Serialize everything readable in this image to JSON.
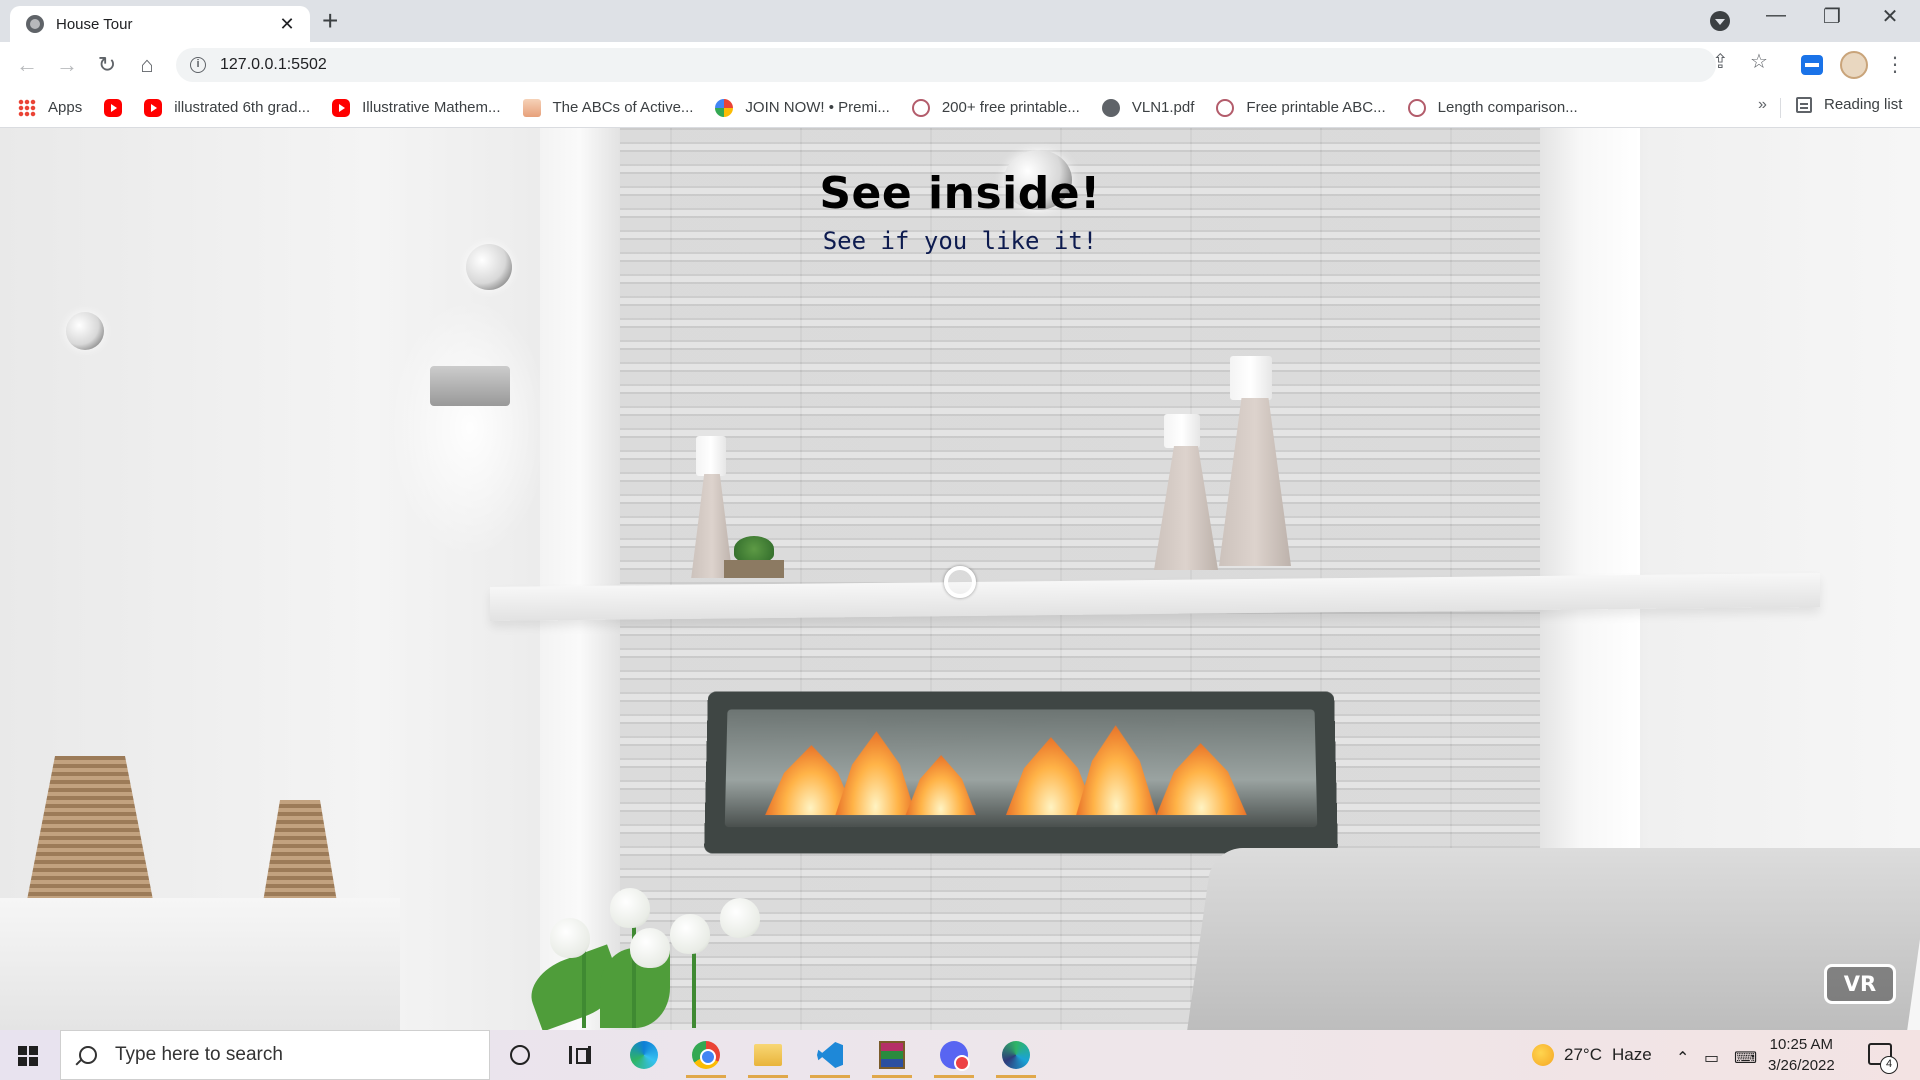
{
  "browser": {
    "tab_title": "House Tour",
    "tab_close": "✕",
    "new_tab": "+",
    "url": "127.0.0.1:5502",
    "window_controls": {
      "minimize": "—",
      "maximize": "❐",
      "close": "✕"
    },
    "nav": {
      "back": "←",
      "forward": "→",
      "reload": "↻",
      "home": "⌂"
    },
    "omnibox_actions": {
      "share": "⇪",
      "bookmark": "☆"
    },
    "menu": "⋮",
    "bookmarks": [
      {
        "label": "Apps",
        "icon": "apps-grid-icon"
      },
      {
        "label": "",
        "icon": "youtube-icon"
      },
      {
        "label": "illustrated 6th grad...",
        "icon": "youtube-icon"
      },
      {
        "label": "Illustrative Mathem...",
        "icon": "youtube-icon"
      },
      {
        "label": "The ABCs of Active...",
        "icon": "abc-icon"
      },
      {
        "label": "JOIN NOW! • Premi...",
        "icon": "multicolor-icon"
      },
      {
        "label": "200+ free printable...",
        "icon": "circle-logo-icon"
      },
      {
        "label": "VLN1.pdf",
        "icon": "globe-icon"
      },
      {
        "label": "Free printable ABC...",
        "icon": "circle-logo-icon"
      },
      {
        "label": "Length comparison...",
        "icon": "circle-logo-icon"
      }
    ],
    "bookmarks_overflow": "»",
    "reading_list": "Reading list"
  },
  "page": {
    "title": "See inside!",
    "subtitle": "See if you like it!",
    "vr_button": "VR"
  },
  "taskbar": {
    "search_placeholder": "Type here to search",
    "apps": [
      "cortana-icon",
      "task-view-icon",
      "edge-icon",
      "chrome-icon",
      "file-explorer-icon",
      "vscode-icon",
      "winrar-icon",
      "discord-icon",
      "edge-dev-icon"
    ],
    "weather": {
      "temp": "27°C",
      "condition": "Haze"
    },
    "time": "10:25 AM",
    "date": "3/26/2022",
    "notifications": "4"
  }
}
